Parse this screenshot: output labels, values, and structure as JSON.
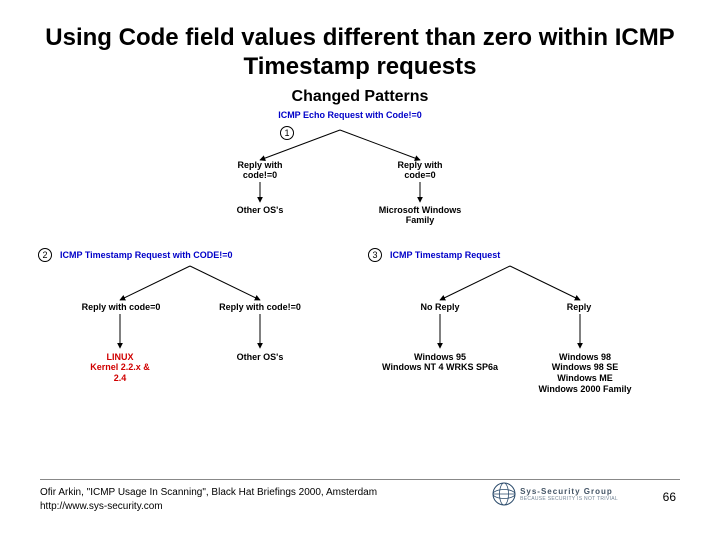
{
  "title": "Using Code field values different than zero within ICMP Timestamp requests",
  "subtitle": "Changed Patterns",
  "diagram": {
    "d1": {
      "header": "ICMP Echo Request with Code!=0",
      "num": "1",
      "left": {
        "branch": "Reply with code!=0",
        "leaf": "Other OS's"
      },
      "right": {
        "branch": "Reply with code=0",
        "leaf": "Microsoft Windows Family"
      }
    },
    "d2": {
      "header": "ICMP Timestamp Request with CODE!=0",
      "num": "2",
      "left": {
        "branch": "Reply with code=0",
        "leaf_a": "LINUX",
        "leaf_b": "Kernel 2.2.x & 2.4"
      },
      "right": {
        "branch": "Reply with code!=0",
        "leaf": "Other OS's"
      }
    },
    "d3": {
      "header": "ICMP Timestamp Request",
      "num": "3",
      "left": {
        "branch": "No Reply",
        "leaf": "Windows 95\nWindows NT 4 WRKS SP6a"
      },
      "right": {
        "branch": "Reply",
        "leaf": "Windows 98\nWindows 98 SE\nWindows ME\nWindows 2000 Family"
      }
    }
  },
  "footer": {
    "line1": "Ofir Arkin, \"ICMP Usage In Scanning\", Black Hat Briefings 2000, Amsterdam",
    "line2": "http://www.sys-security.com",
    "logo_text": "Sys-Security Group",
    "logo_sub": "BECAUSE SECURITY IS NOT TRIVIAL",
    "page": "66"
  }
}
